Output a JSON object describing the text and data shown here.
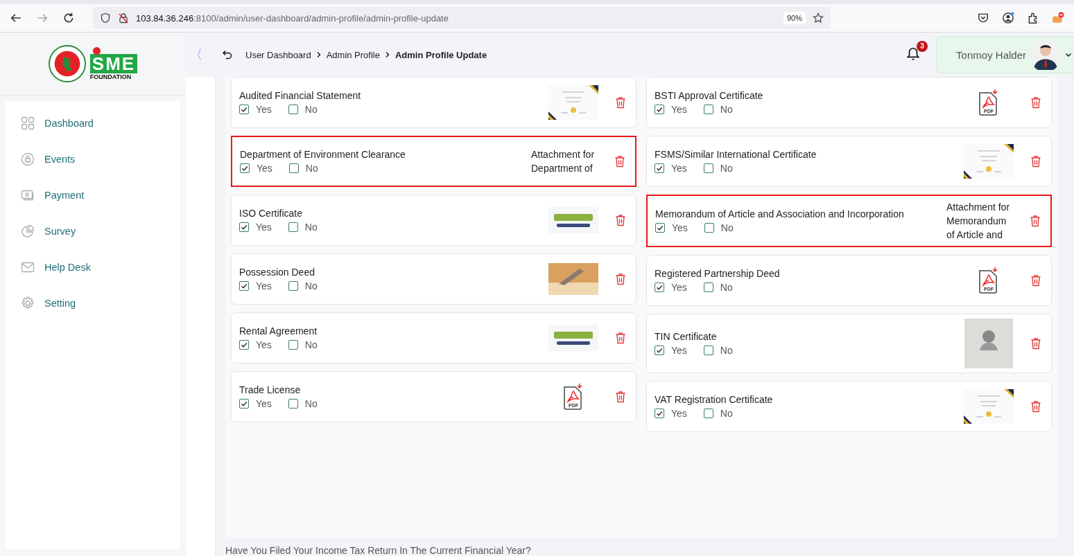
{
  "browser": {
    "url_host": "103.84.36.246",
    "url_rest": ":8100/admin/user-dashboard/admin-profile/admin-profile-update",
    "zoom": "90%"
  },
  "logo": {
    "text": "SME",
    "subtext": "FOUNDATION"
  },
  "sidebar": {
    "items": [
      {
        "label": "Dashboard",
        "kind": "grid"
      },
      {
        "label": "Events",
        "kind": "lock"
      },
      {
        "label": "Payment",
        "kind": "cash"
      },
      {
        "label": "Survey",
        "kind": "pie"
      },
      {
        "label": "Help Desk",
        "kind": "mail"
      },
      {
        "label": "Setting",
        "kind": "gear"
      }
    ]
  },
  "topbar": {
    "collapse": "〈",
    "breadcrumbs": [
      {
        "label": "User Dashboard",
        "current": false
      },
      {
        "label": "Admin Profile",
        "current": false
      },
      {
        "label": "Admin Profile Update",
        "current": true
      }
    ],
    "notifications": "3",
    "user": "Tonmoy Halder"
  },
  "documents": [
    {
      "title": "Audited Financial Statement",
      "options": [
        {
          "label": "Yes",
          "checked": true
        },
        {
          "label": "No",
          "checked": false
        }
      ],
      "attachment": {
        "kind": "certificate"
      },
      "highlighted": false
    },
    {
      "title": "Department of Environment Clearance",
      "options": [
        {
          "label": "Yes",
          "checked": true
        },
        {
          "label": "No",
          "checked": false
        }
      ],
      "attachment": {
        "kind": "text",
        "text": "Attachment for Department of"
      },
      "highlighted": true
    },
    {
      "title": "ISO Certificate",
      "options": [
        {
          "label": "Yes",
          "checked": true
        },
        {
          "label": "No",
          "checked": false
        }
      ],
      "attachment": {
        "kind": "logo"
      },
      "highlighted": false
    },
    {
      "title": "Possession Deed",
      "options": [
        {
          "label": "Yes",
          "checked": true
        },
        {
          "label": "No",
          "checked": false
        }
      ],
      "attachment": {
        "kind": "photo"
      },
      "highlighted": false
    },
    {
      "title": "Rental Agreement",
      "options": [
        {
          "label": "Yes",
          "checked": true
        },
        {
          "label": "No",
          "checked": false
        }
      ],
      "attachment": {
        "kind": "logo"
      },
      "highlighted": false
    },
    {
      "title": "Trade License",
      "options": [
        {
          "label": "Yes",
          "checked": true
        },
        {
          "label": "No",
          "checked": false
        }
      ],
      "attachment": {
        "kind": "pdf",
        "label": "PDF"
      },
      "highlighted": false
    },
    {
      "title": "BSTI Approval Certificate",
      "options": [
        {
          "label": "Yes",
          "checked": true
        },
        {
          "label": "No",
          "checked": false
        }
      ],
      "attachment": {
        "kind": "pdf",
        "label": "PDF"
      },
      "highlighted": false
    },
    {
      "title": "FSMS/Similar International Certificate",
      "options": [
        {
          "label": "Yes",
          "checked": true
        },
        {
          "label": "No",
          "checked": false
        }
      ],
      "attachment": {
        "kind": "certificate"
      },
      "highlighted": false
    },
    {
      "title": "Memorandum of Article and Association and Incorporation",
      "options": [
        {
          "label": "Yes",
          "checked": true
        },
        {
          "label": "No",
          "checked": false
        }
      ],
      "attachment": {
        "kind": "text",
        "text": "Attachment for Memorandum of Article and"
      },
      "highlighted": true
    },
    {
      "title": "Registered Partnership Deed",
      "options": [
        {
          "label": "Yes",
          "checked": true
        },
        {
          "label": "No",
          "checked": false
        }
      ],
      "attachment": {
        "kind": "pdf",
        "label": "PDF"
      },
      "highlighted": false
    },
    {
      "title": "TIN Certificate",
      "options": [
        {
          "label": "Yes",
          "checked": true
        },
        {
          "label": "No",
          "checked": false
        }
      ],
      "attachment": {
        "kind": "photo-grey"
      },
      "highlighted": false
    },
    {
      "title": "VAT Registration Certificate",
      "options": [
        {
          "label": "Yes",
          "checked": true
        },
        {
          "label": "No",
          "checked": false
        }
      ],
      "attachment": {
        "kind": "certificate"
      },
      "highlighted": false
    }
  ],
  "question": "Have You Filed Your Income Tax Return In The Current Financial Year?"
}
